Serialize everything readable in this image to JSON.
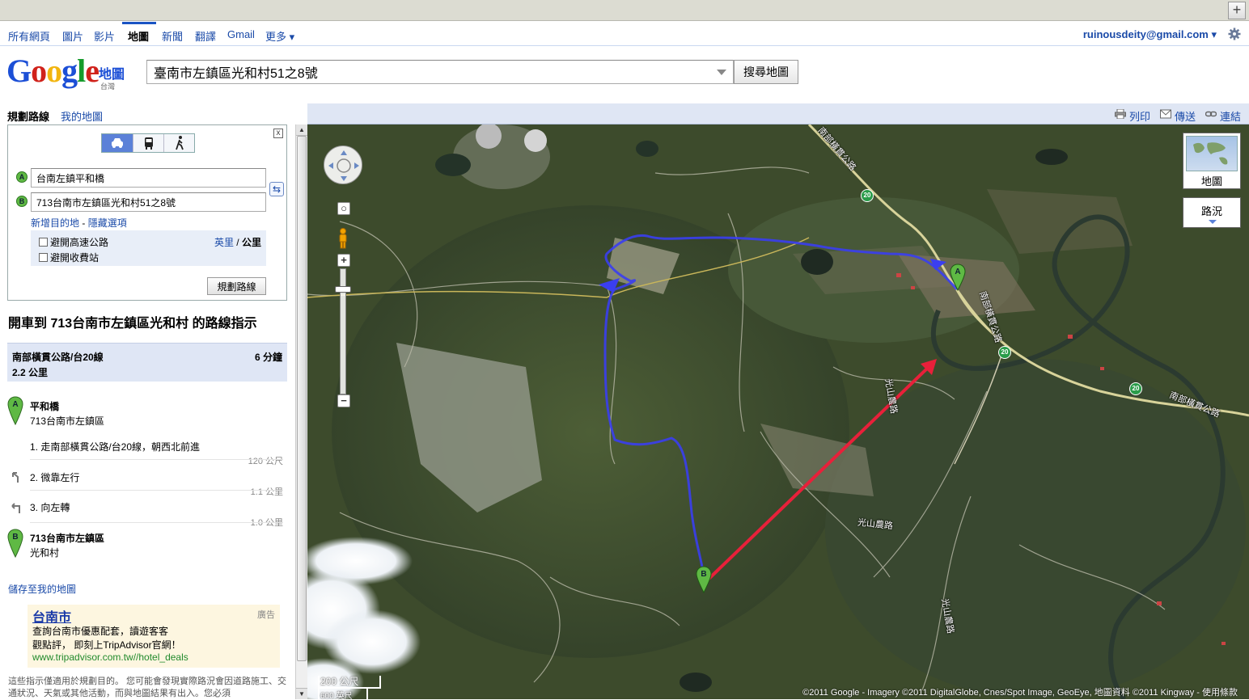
{
  "browser": {
    "plus_label": "+"
  },
  "nav": {
    "items": [
      {
        "label": "所有網頁",
        "active": false
      },
      {
        "label": "圖片",
        "active": false
      },
      {
        "label": "影片",
        "active": false
      },
      {
        "label": "地圖",
        "active": true
      },
      {
        "label": "新聞",
        "active": false
      },
      {
        "label": "翻譯",
        "active": false
      },
      {
        "label": "Gmail",
        "active": false
      },
      {
        "label": "更多 ▾",
        "active": false
      }
    ],
    "account": "ruinousdeity@gmail.com ▾"
  },
  "header": {
    "logo_sub": "地圖",
    "logo_region": "台灣",
    "search_value": "臺南市左鎮區光和村51之8號",
    "search_button": "搜尋地圖"
  },
  "sidebar": {
    "tab_directions": "規劃路線",
    "tab_mymaps": "我的地圖",
    "collapse": "«",
    "route": {
      "close": "x",
      "marker_a": "A",
      "marker_b": "B",
      "start_value": "台南左鎮平和橋",
      "end_value": "713台南市左鎮區光和村51之8號",
      "swap": "⇆",
      "add_destination": "新增目的地",
      "separator": " - ",
      "hide_options": "隱藏選項",
      "avoid_highways": "避開高速公路",
      "avoid_tolls": "避開收費站",
      "unit_miles": "英里",
      "unit_sep": " / ",
      "unit_km": "公里",
      "plan_button": "規劃路線"
    },
    "directions_title": "開車到 713台南市左鎮區光和村 的路線指示",
    "summary": {
      "road": "南部橫貫公路/台20線",
      "time": "6 分鐘",
      "distance": "2.2 公里"
    },
    "start": {
      "marker": "A",
      "title": "平和橋",
      "subtitle": "713台南市左鎮區"
    },
    "steps": [
      {
        "text": "1. 走南部橫貫公路/台20線，朝西北前進",
        "distance": "120 公尺"
      },
      {
        "text": "2. 微靠左行",
        "distance": "1.1 公里"
      },
      {
        "text": "3. 向左轉",
        "distance": "1.0 公里"
      }
    ],
    "end": {
      "marker": "B",
      "title": "713台南市左鎮區",
      "subtitle": "光和村"
    },
    "save_link": "儲存至我的地圖",
    "ad": {
      "title": "台南市",
      "label": "廣告",
      "line1": "查詢台南市優惠配套，讀遊客客",
      "line2": "觀點評， 即刻上TripAdvisor官網！",
      "url": "www.tripadvisor.com.tw//hotel_deals"
    },
    "disclaimer": "這些指示僅適用於規劃目的。 您可能會發現實際路況會因道路施工、交通狀況、天氣或其他活動，而與地圖結果有出入。您必須"
  },
  "map_toolbar": {
    "print": "列印",
    "send": "傳送",
    "link": "連結"
  },
  "map": {
    "type_label": "地圖",
    "traffic_label": "路況",
    "scale_label": "200 公尺",
    "scale_label2": "600 英尺",
    "zoom_in": "+",
    "zoom_out": "−",
    "marker_a": "A",
    "marker_b": "B",
    "copyright": "©2011 Google - Imagery ©2011 DigitalGlobe, Cnes/Spot Image, GeoEye, 地圖資料 ©2011 Kingway - 使用條款",
    "road_labels": {
      "road_north": "南部橫貫公路",
      "road_east": "南部橫貫公路",
      "road_ne": "南部橫貫公路",
      "guangshan_1": "光山農路",
      "guangshan_2": "光山農路",
      "guangshan_3": "光山農路"
    },
    "shield": "20",
    "colors": {
      "route": "#3a3ef0",
      "arrow": "#e8203a",
      "marker": "#5fb944"
    }
  }
}
